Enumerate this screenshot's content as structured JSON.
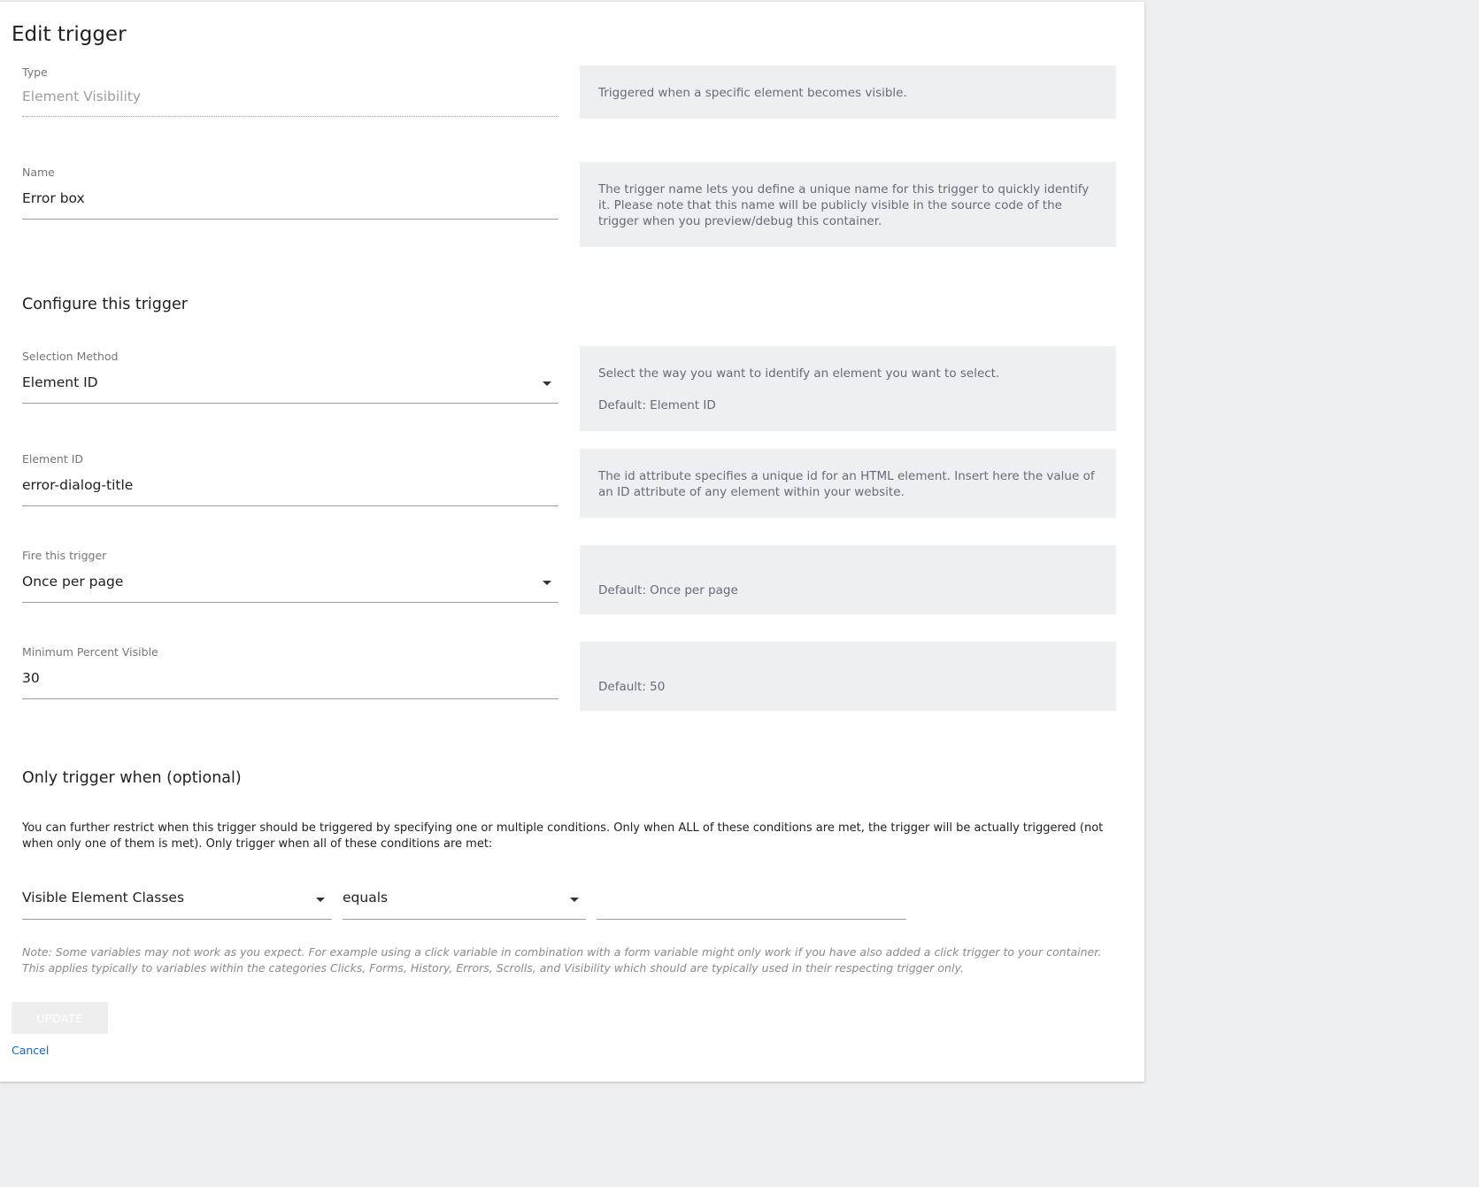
{
  "page": {
    "title": "Edit trigger"
  },
  "type_field": {
    "label": "Type",
    "value": "Element Visibility",
    "help": "Triggered when a specific element becomes visible."
  },
  "name_field": {
    "label": "Name",
    "value": "Error box",
    "help": "The trigger name lets you define a unique name for this trigger to quickly identify it. Please note that this name will be publicly visible in the source code of the trigger when you preview/debug this container."
  },
  "configure": {
    "heading": "Configure this trigger",
    "selection_method": {
      "label": "Selection Method",
      "value": "Element ID",
      "help_line1": "Select the way you want to identify an element you want to select.",
      "help_line2": "Default: Element ID"
    },
    "element_id": {
      "label": "Element ID",
      "value": "error-dialog-title",
      "help": "The id attribute specifies a unique id for an HTML element. Insert here the value of an ID attribute of any element within your website."
    },
    "fire": {
      "label": "Fire this trigger",
      "value": "Once per page",
      "help": "Default: Once per page"
    },
    "min_percent": {
      "label": "Minimum Percent Visible",
      "value": "30",
      "help": "Default: 50"
    }
  },
  "conditions": {
    "heading": "Only trigger when (optional)",
    "description": "You can further restrict when this trigger should be triggered by specifying one or multiple conditions. Only when ALL of these conditions are met, the trigger will be actually triggered (not when only one of them is met). Only trigger when all of these conditions are met:",
    "variable": "Visible Element Classes",
    "operator": "equals",
    "value": "",
    "note": "Note: Some variables may not work as you expect. For example using a click variable in combination with a form variable might only work if you have also added a click trigger to your container. This applies typically to variables within the categories Clicks, Forms, History, Errors, Scrolls, and Visibility which should are typically used in their respecting trigger only."
  },
  "actions": {
    "update_label": "UPDATE",
    "cancel_label": "Cancel"
  },
  "colors": {
    "link": "#1565c0",
    "help_bg": "#eeeff1",
    "page_bg": "#eeeff1"
  }
}
